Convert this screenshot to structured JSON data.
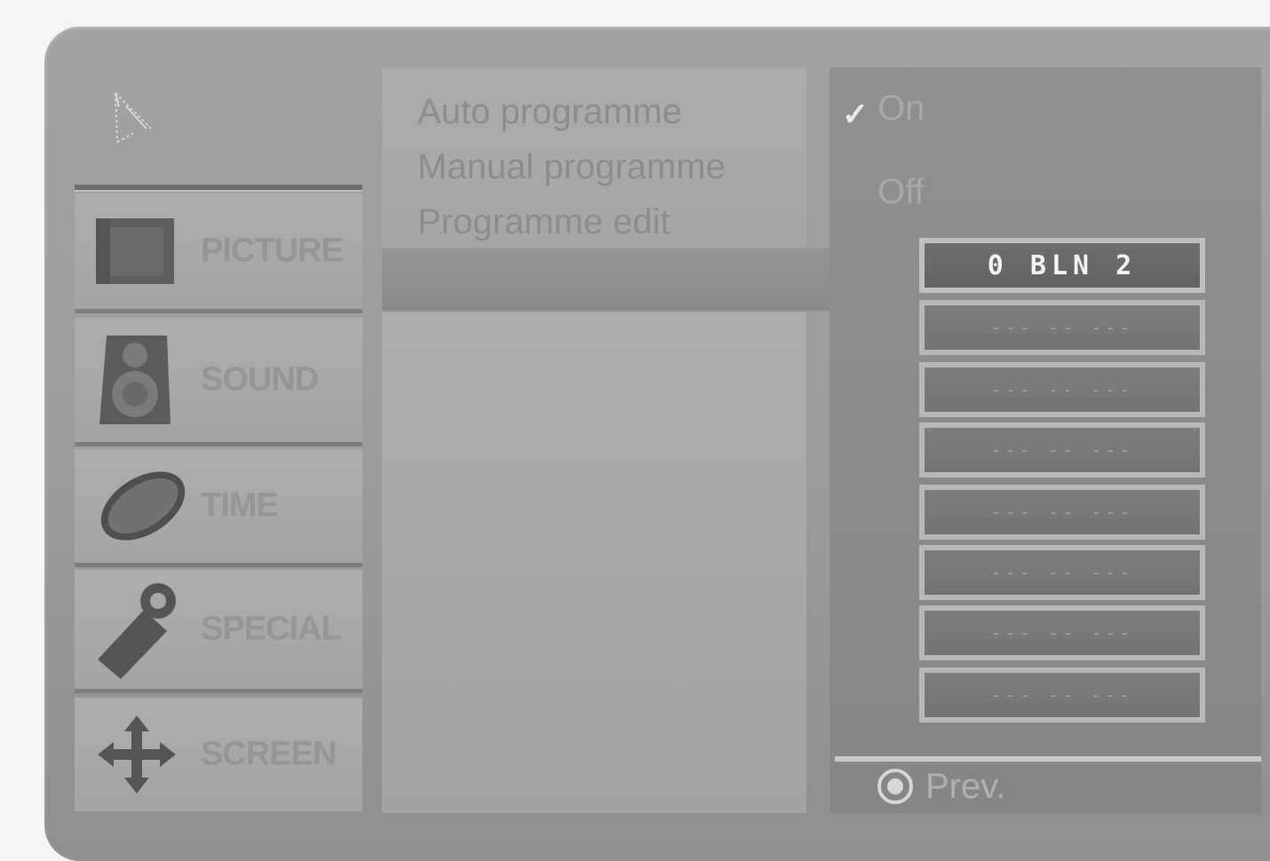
{
  "sidebar": {
    "items": [
      {
        "label": "PICTURE",
        "icon": "picture-frame-icon"
      },
      {
        "label": "SOUND",
        "icon": "speaker-icon"
      },
      {
        "label": "TIME",
        "icon": "clock-icon"
      },
      {
        "label": "SPECIAL",
        "icon": "tag-icon"
      },
      {
        "label": "SCREEN",
        "icon": "move-arrows-icon"
      }
    ]
  },
  "menu": {
    "items": [
      "Auto programme",
      "Manual programme",
      "Programme edit"
    ]
  },
  "options": {
    "on_label": "On",
    "off_label": "Off",
    "check_glyph": "✓"
  },
  "slots": [
    "0 BLN 2",
    "--- -- ---",
    "--- -- ---",
    "--- -- ---",
    "--- -- ---",
    "--- -- ---",
    "--- -- ---",
    "--- -- ---"
  ],
  "footer": {
    "prev_label": "Prev."
  }
}
